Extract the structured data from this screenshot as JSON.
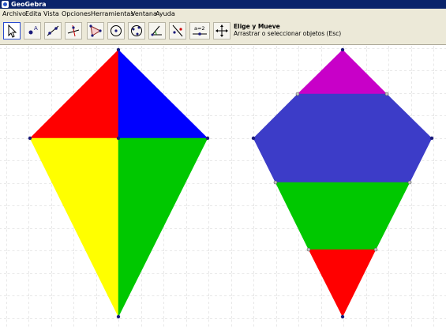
{
  "window": {
    "title": "GeoGebra"
  },
  "menu": {
    "items": [
      "Archivo",
      "Edita",
      "Vista",
      "Opciones",
      "Herramientas",
      "Ventana",
      "Ayuda"
    ]
  },
  "toolbar": {
    "tools": [
      "move-tool-icon",
      "point-tool-icon",
      "line-tool-icon",
      "perpendicular-tool-icon",
      "polygon-tool-icon",
      "circle-tool-icon",
      "conic-tool-icon",
      "angle-tool-icon",
      "reflect-tool-icon",
      "slider-tool-icon",
      "move-view-tool-icon"
    ],
    "slider_text": "a=2",
    "active_tool_name": "Elige y Mueve",
    "active_tool_help": "Arrastrar o seleccionar objetos (Esc)"
  },
  "colors": {
    "red": "#ff0000",
    "blue": "#0000ff",
    "yellow": "#ffff00",
    "green": "#00c800",
    "magenta": "#c800c8",
    "slate_blue": "#3c3cc8",
    "point": "#1a1a7a"
  }
}
